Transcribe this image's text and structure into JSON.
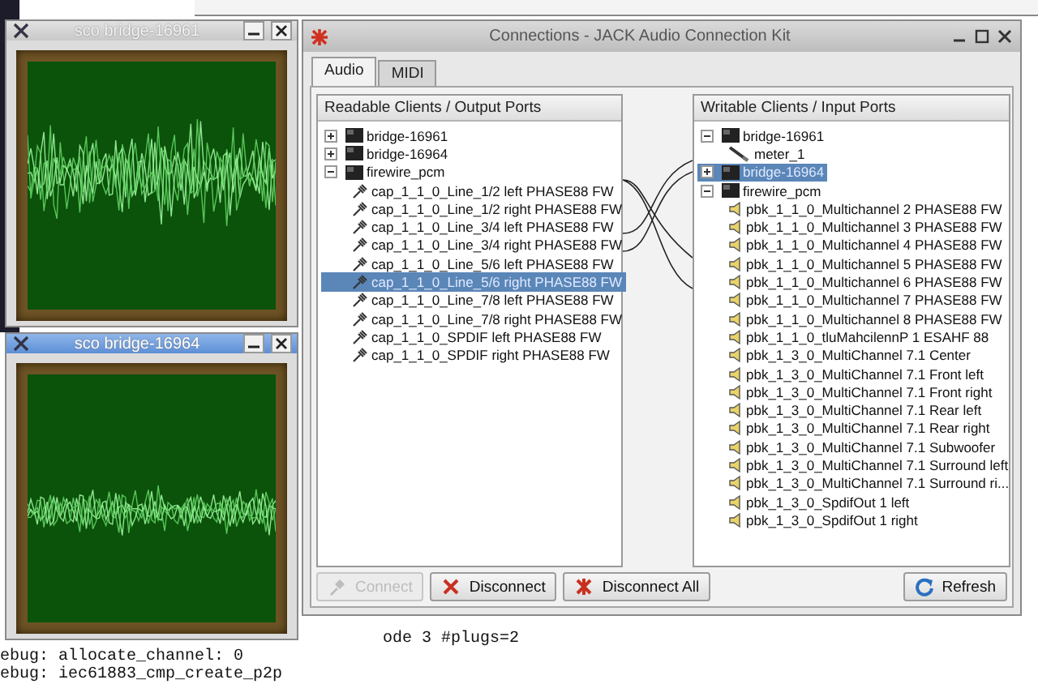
{
  "scopes": [
    {
      "title": "sco bridge-16961",
      "active": false
    },
    {
      "title": "sco bridge-16964",
      "active": true
    }
  ],
  "connections_window": {
    "title": "Connections - JACK Audio Connection Kit",
    "tabs": [
      {
        "label": "Audio",
        "selected": true
      },
      {
        "label": "MIDI",
        "selected": false
      }
    ],
    "output_panel": {
      "header": "Readable Clients / Output Ports",
      "tree": [
        {
          "kind": "client",
          "label": "bridge-16961",
          "expanded": false,
          "selected": false
        },
        {
          "kind": "client",
          "label": "bridge-16964",
          "expanded": false,
          "selected": false
        },
        {
          "kind": "client",
          "label": "firewire_pcm",
          "expanded": true,
          "selected": false,
          "children": [
            {
              "kind": "output_port",
              "label": "cap_1_1_0_Line_1/2 left PHASE88 FW",
              "selected": false
            },
            {
              "kind": "output_port",
              "label": "cap_1_1_0_Line_1/2 right PHASE88 FW",
              "selected": false
            },
            {
              "kind": "output_port",
              "label": "cap_1_1_0_Line_3/4 left PHASE88 FW",
              "selected": false
            },
            {
              "kind": "output_port",
              "label": "cap_1_1_0_Line_3/4 right PHASE88 FW",
              "selected": false
            },
            {
              "kind": "output_port",
              "label": "cap_1_1_0_Line_5/6 left PHASE88 FW",
              "selected": false
            },
            {
              "kind": "output_port",
              "label": "cap_1_1_0_Line_5/6 right PHASE88 FW",
              "selected": true
            },
            {
              "kind": "output_port",
              "label": "cap_1_1_0_Line_7/8 left PHASE88 FW",
              "selected": false
            },
            {
              "kind": "output_port",
              "label": "cap_1_1_0_Line_7/8 right PHASE88 FW",
              "selected": false
            },
            {
              "kind": "output_port",
              "label": "cap_1_1_0_SPDIF left PHASE88 FW",
              "selected": false
            },
            {
              "kind": "output_port",
              "label": "cap_1_1_0_SPDIF right PHASE88 FW",
              "selected": false
            }
          ]
        }
      ]
    },
    "input_panel": {
      "header": "Writable Clients / Input Ports",
      "tree": [
        {
          "kind": "client",
          "label": "bridge-16961",
          "expanded": true,
          "selected": false,
          "children": [
            {
              "kind": "meter_port",
              "label": "meter_1",
              "selected": false
            }
          ]
        },
        {
          "kind": "client",
          "label": "bridge-16964",
          "expanded": false,
          "selected": true
        },
        {
          "kind": "client",
          "label": "firewire_pcm",
          "expanded": true,
          "selected": false,
          "children": [
            {
              "kind": "input_port",
              "label": "pbk_1_1_0_Multichannel 2 PHASE88 FW",
              "selected": false
            },
            {
              "kind": "input_port",
              "label": "pbk_1_1_0_Multichannel 3 PHASE88 FW",
              "selected": false
            },
            {
              "kind": "input_port",
              "label": "pbk_1_1_0_Multichannel 4 PHASE88 FW",
              "selected": false
            },
            {
              "kind": "input_port",
              "label": "pbk_1_1_0_Multichannel 5 PHASE88 FW",
              "selected": false
            },
            {
              "kind": "input_port",
              "label": "pbk_1_1_0_Multichannel 6 PHASE88 FW",
              "selected": false
            },
            {
              "kind": "input_port",
              "label": "pbk_1_1_0_Multichannel 7 PHASE88 FW",
              "selected": false
            },
            {
              "kind": "input_port",
              "label": "pbk_1_1_0_Multichannel 8 PHASE88 FW",
              "selected": false
            },
            {
              "kind": "input_port",
              "label": "pbk_1_1_0_tluMahcilennP 1 ESAHF 88",
              "selected": false
            },
            {
              "kind": "input_port",
              "label": "pbk_1_3_0_MultiChannel 7.1 Center",
              "selected": false
            },
            {
              "kind": "input_port",
              "label": "pbk_1_3_0_MultiChannel 7.1 Front left",
              "selected": false
            },
            {
              "kind": "input_port",
              "label": "pbk_1_3_0_MultiChannel 7.1 Front right",
              "selected": false
            },
            {
              "kind": "input_port",
              "label": "pbk_1_3_0_MultiChannel 7.1 Rear left",
              "selected": false
            },
            {
              "kind": "input_port",
              "label": "pbk_1_3_0_MultiChannel 7.1 Rear right",
              "selected": false
            },
            {
              "kind": "input_port",
              "label": "pbk_1_3_0_MultiChannel 7.1 Subwoofer",
              "selected": false
            },
            {
              "kind": "input_port",
              "label": "pbk_1_3_0_MultiChannel 7.1 Surround left",
              "selected": false
            },
            {
              "kind": "input_port",
              "label": "pbk_1_3_0_MultiChannel 7.1 Surround ri...",
              "selected": false
            },
            {
              "kind": "input_port",
              "label": "pbk_1_3_0_SpdifOut 1 left",
              "selected": false
            },
            {
              "kind": "input_port",
              "label": "pbk_1_3_0_SpdifOut 1 right",
              "selected": false
            }
          ]
        }
      ]
    },
    "buttons": [
      {
        "kind": "connect",
        "label": "Connect",
        "disabled": true
      },
      {
        "kind": "disconnect",
        "label": "Disconnect",
        "disabled": false
      },
      {
        "kind": "disconnect_all",
        "label": "Disconnect All",
        "disabled": false
      },
      {
        "kind": "refresh",
        "label": "Refresh",
        "disabled": false
      }
    ]
  },
  "terminal": {
    "lines": [
      "ode 3 #plugs=2",
      "ebug: allocate_channel: 0",
      "ebug: iec61883_cmp_create_p2p"
    ]
  }
}
